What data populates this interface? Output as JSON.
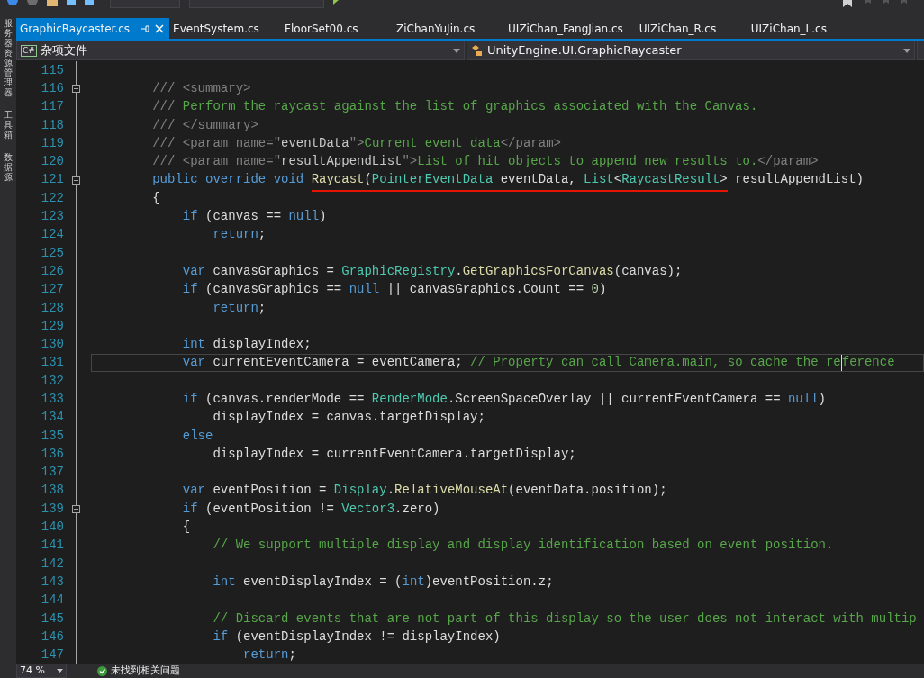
{
  "side_tabs": [
    "服务器资源管理器",
    "工具箱",
    "数据源"
  ],
  "tabs": [
    {
      "label": "GraphicRaycaster.cs",
      "selected": true
    },
    {
      "label": "EventSystem.cs",
      "selected": false
    },
    {
      "label": "FloorSet00.cs",
      "selected": false
    },
    {
      "label": "ZiChanYuJin.cs",
      "selected": false
    },
    {
      "label": "UIZiChan_FangJian.cs",
      "selected": false
    },
    {
      "label": "UIZiChan_R.cs",
      "selected": false
    },
    {
      "label": "UIZiChan_L.cs",
      "selected": false
    }
  ],
  "navigation": {
    "project_badge": "C#",
    "project": "杂项文件",
    "type": "UnityEngine.UI.GraphicRaycaster"
  },
  "lines": [
    {
      "number": "115"
    },
    {
      "number": "116",
      "fold": true,
      "tokens": [
        {
          "kind": "doc",
          "text": "        /// <summary>"
        }
      ]
    },
    {
      "number": "117",
      "tokens": [
        {
          "kind": "doc",
          "text": "        ///"
        },
        {
          "kind": "comment",
          "text": " Perform the raycast against the list of graphics associated with the Canvas."
        }
      ]
    },
    {
      "number": "118",
      "tokens": [
        {
          "kind": "doc",
          "text": "        /// </summary>"
        }
      ]
    },
    {
      "number": "119",
      "tokens": [
        {
          "kind": "doc",
          "text": "        /// <param name=\""
        },
        {
          "kind": "docname",
          "text": "eventData"
        },
        {
          "kind": "doc",
          "text": "\">"
        },
        {
          "kind": "comment",
          "text": "Current event data"
        },
        {
          "kind": "doc",
          "text": "</param>"
        }
      ]
    },
    {
      "number": "120",
      "tokens": [
        {
          "kind": "doc",
          "text": "        /// <param name=\""
        },
        {
          "kind": "docname",
          "text": "resultAppendList"
        },
        {
          "kind": "doc",
          "text": "\">"
        },
        {
          "kind": "comment",
          "text": "List of hit objects to append new results to."
        },
        {
          "kind": "doc",
          "text": "</param>"
        }
      ]
    },
    {
      "number": "121",
      "fold": true,
      "tokens": [
        {
          "kind": "keyword",
          "text": "        public override void "
        },
        {
          "kind": "method",
          "text": "Raycast",
          "underlined": true
        },
        {
          "kind": "plain",
          "text": "(",
          "underlined": true
        },
        {
          "kind": "type",
          "text": "PointerEventData",
          "underlined": true
        },
        {
          "kind": "plain",
          "text": " eventData, ",
          "underlined": true
        },
        {
          "kind": "type",
          "text": "List",
          "underlined": true
        },
        {
          "kind": "plain",
          "text": "<",
          "underlined": true
        },
        {
          "kind": "type",
          "text": "RaycastResult",
          "underlined": true
        },
        {
          "kind": "plain",
          "text": ">",
          "underlined": true
        },
        {
          "kind": "plain",
          "text": " resultAppendList)"
        }
      ]
    },
    {
      "number": "122",
      "tokens": [
        {
          "kind": "plain",
          "text": "        {"
        }
      ]
    },
    {
      "number": "123",
      "tokens": [
        {
          "kind": "keyword",
          "text": "            if"
        },
        {
          "kind": "plain",
          "text": " (canvas == "
        },
        {
          "kind": "keyword",
          "text": "null"
        },
        {
          "kind": "plain",
          "text": ")"
        }
      ]
    },
    {
      "number": "124",
      "tokens": [
        {
          "kind": "keyword",
          "text": "                return"
        },
        {
          "kind": "plain",
          "text": ";"
        }
      ]
    },
    {
      "number": "125"
    },
    {
      "number": "126",
      "tokens": [
        {
          "kind": "keyword",
          "text": "            var"
        },
        {
          "kind": "plain",
          "text": " canvasGraphics = "
        },
        {
          "kind": "type",
          "text": "GraphicRegistry"
        },
        {
          "kind": "plain",
          "text": "."
        },
        {
          "kind": "method",
          "text": "GetGraphicsForCanvas"
        },
        {
          "kind": "plain",
          "text": "(canvas);"
        }
      ]
    },
    {
      "number": "127",
      "tokens": [
        {
          "kind": "keyword",
          "text": "            if"
        },
        {
          "kind": "plain",
          "text": " (canvasGraphics == "
        },
        {
          "kind": "keyword",
          "text": "null"
        },
        {
          "kind": "plain",
          "text": " || canvasGraphics.Count == "
        },
        {
          "kind": "number",
          "text": "0"
        },
        {
          "kind": "plain",
          "text": ")"
        }
      ]
    },
    {
      "number": "128",
      "tokens": [
        {
          "kind": "keyword",
          "text": "                return"
        },
        {
          "kind": "plain",
          "text": ";"
        }
      ]
    },
    {
      "number": "129"
    },
    {
      "number": "130",
      "tokens": [
        {
          "kind": "keyword",
          "text": "            int"
        },
        {
          "kind": "plain",
          "text": " displayIndex;"
        }
      ]
    },
    {
      "number": "131",
      "current": true,
      "tokens": [
        {
          "kind": "keyword",
          "text": "            var"
        },
        {
          "kind": "plain",
          "text": " currentEventCamera = eventCamera; "
        },
        {
          "kind": "comment",
          "text": "// Property can call Camera.main, so cache the re",
          "caret_after": true
        },
        {
          "kind": "comment",
          "text": "ference"
        }
      ]
    },
    {
      "number": "132"
    },
    {
      "number": "133",
      "tokens": [
        {
          "kind": "keyword",
          "text": "            if"
        },
        {
          "kind": "plain",
          "text": " (canvas.renderMode == "
        },
        {
          "kind": "type",
          "text": "RenderMode"
        },
        {
          "kind": "plain",
          "text": ".ScreenSpaceOverlay || currentEventCamera == "
        },
        {
          "kind": "keyword",
          "text": "null"
        },
        {
          "kind": "plain",
          "text": ")"
        }
      ]
    },
    {
      "number": "134",
      "tokens": [
        {
          "kind": "plain",
          "text": "                displayIndex = canvas.targetDisplay;"
        }
      ]
    },
    {
      "number": "135",
      "tokens": [
        {
          "kind": "keyword",
          "text": "            else"
        }
      ]
    },
    {
      "number": "136",
      "tokens": [
        {
          "kind": "plain",
          "text": "                displayIndex = currentEventCamera.targetDisplay;"
        }
      ]
    },
    {
      "number": "137"
    },
    {
      "number": "138",
      "tokens": [
        {
          "kind": "keyword",
          "text": "            var"
        },
        {
          "kind": "plain",
          "text": " eventPosition = "
        },
        {
          "kind": "type",
          "text": "Display"
        },
        {
          "kind": "plain",
          "text": "."
        },
        {
          "kind": "method",
          "text": "RelativeMouseAt"
        },
        {
          "kind": "plain",
          "text": "(eventData.position);"
        }
      ]
    },
    {
      "number": "139",
      "fold": true,
      "tokens": [
        {
          "kind": "keyword",
          "text": "            if"
        },
        {
          "kind": "plain",
          "text": " (eventPosition != "
        },
        {
          "kind": "type",
          "text": "Vector3"
        },
        {
          "kind": "plain",
          "text": ".zero)"
        }
      ]
    },
    {
      "number": "140",
      "tokens": [
        {
          "kind": "plain",
          "text": "            {"
        }
      ]
    },
    {
      "number": "141",
      "tokens": [
        {
          "kind": "comment",
          "text": "                // We support multiple display and display identification based on event position."
        }
      ]
    },
    {
      "number": "142"
    },
    {
      "number": "143",
      "tokens": [
        {
          "kind": "keyword",
          "text": "                int"
        },
        {
          "kind": "plain",
          "text": " eventDisplayIndex = ("
        },
        {
          "kind": "keyword",
          "text": "int"
        },
        {
          "kind": "plain",
          "text": ")eventPosition.z;"
        }
      ]
    },
    {
      "number": "144"
    },
    {
      "number": "145",
      "tokens": [
        {
          "kind": "comment",
          "text": "                // Discard events that are not part of this display so the user does not interact with multip"
        }
      ]
    },
    {
      "number": "146",
      "tokens": [
        {
          "kind": "keyword",
          "text": "                if"
        },
        {
          "kind": "plain",
          "text": " (eventDisplayIndex != displayIndex)"
        }
      ]
    },
    {
      "number": "147",
      "tokens": [
        {
          "kind": "keyword",
          "text": "                    return"
        },
        {
          "kind": "plain",
          "text": ";"
        }
      ]
    }
  ],
  "status_bar": {
    "zoom": "74 %",
    "issues": "未找到相关问题"
  }
}
